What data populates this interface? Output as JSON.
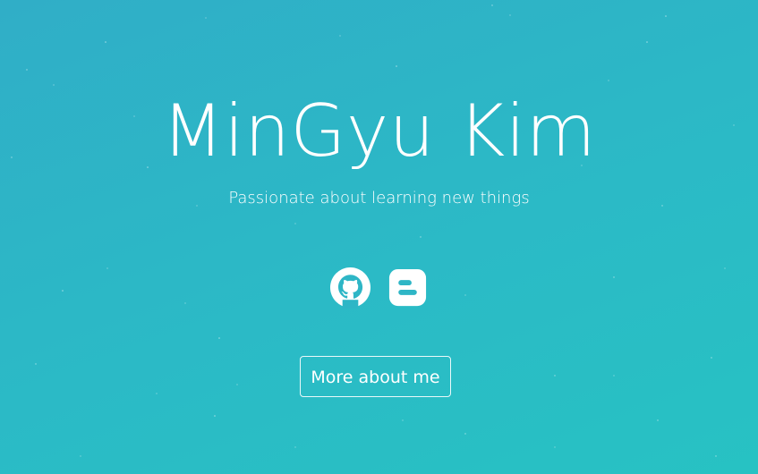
{
  "hero": {
    "name": "MinGyu Kim",
    "tagline": "Passionate about learning new things"
  },
  "social_links": [
    {
      "icon": "github-icon"
    },
    {
      "icon": "blogger-icon"
    }
  ],
  "cta": {
    "label": "More about me"
  },
  "colors": {
    "background_start": "#30aec7",
    "background_end": "#27c2c3",
    "text": "#ffffff"
  }
}
